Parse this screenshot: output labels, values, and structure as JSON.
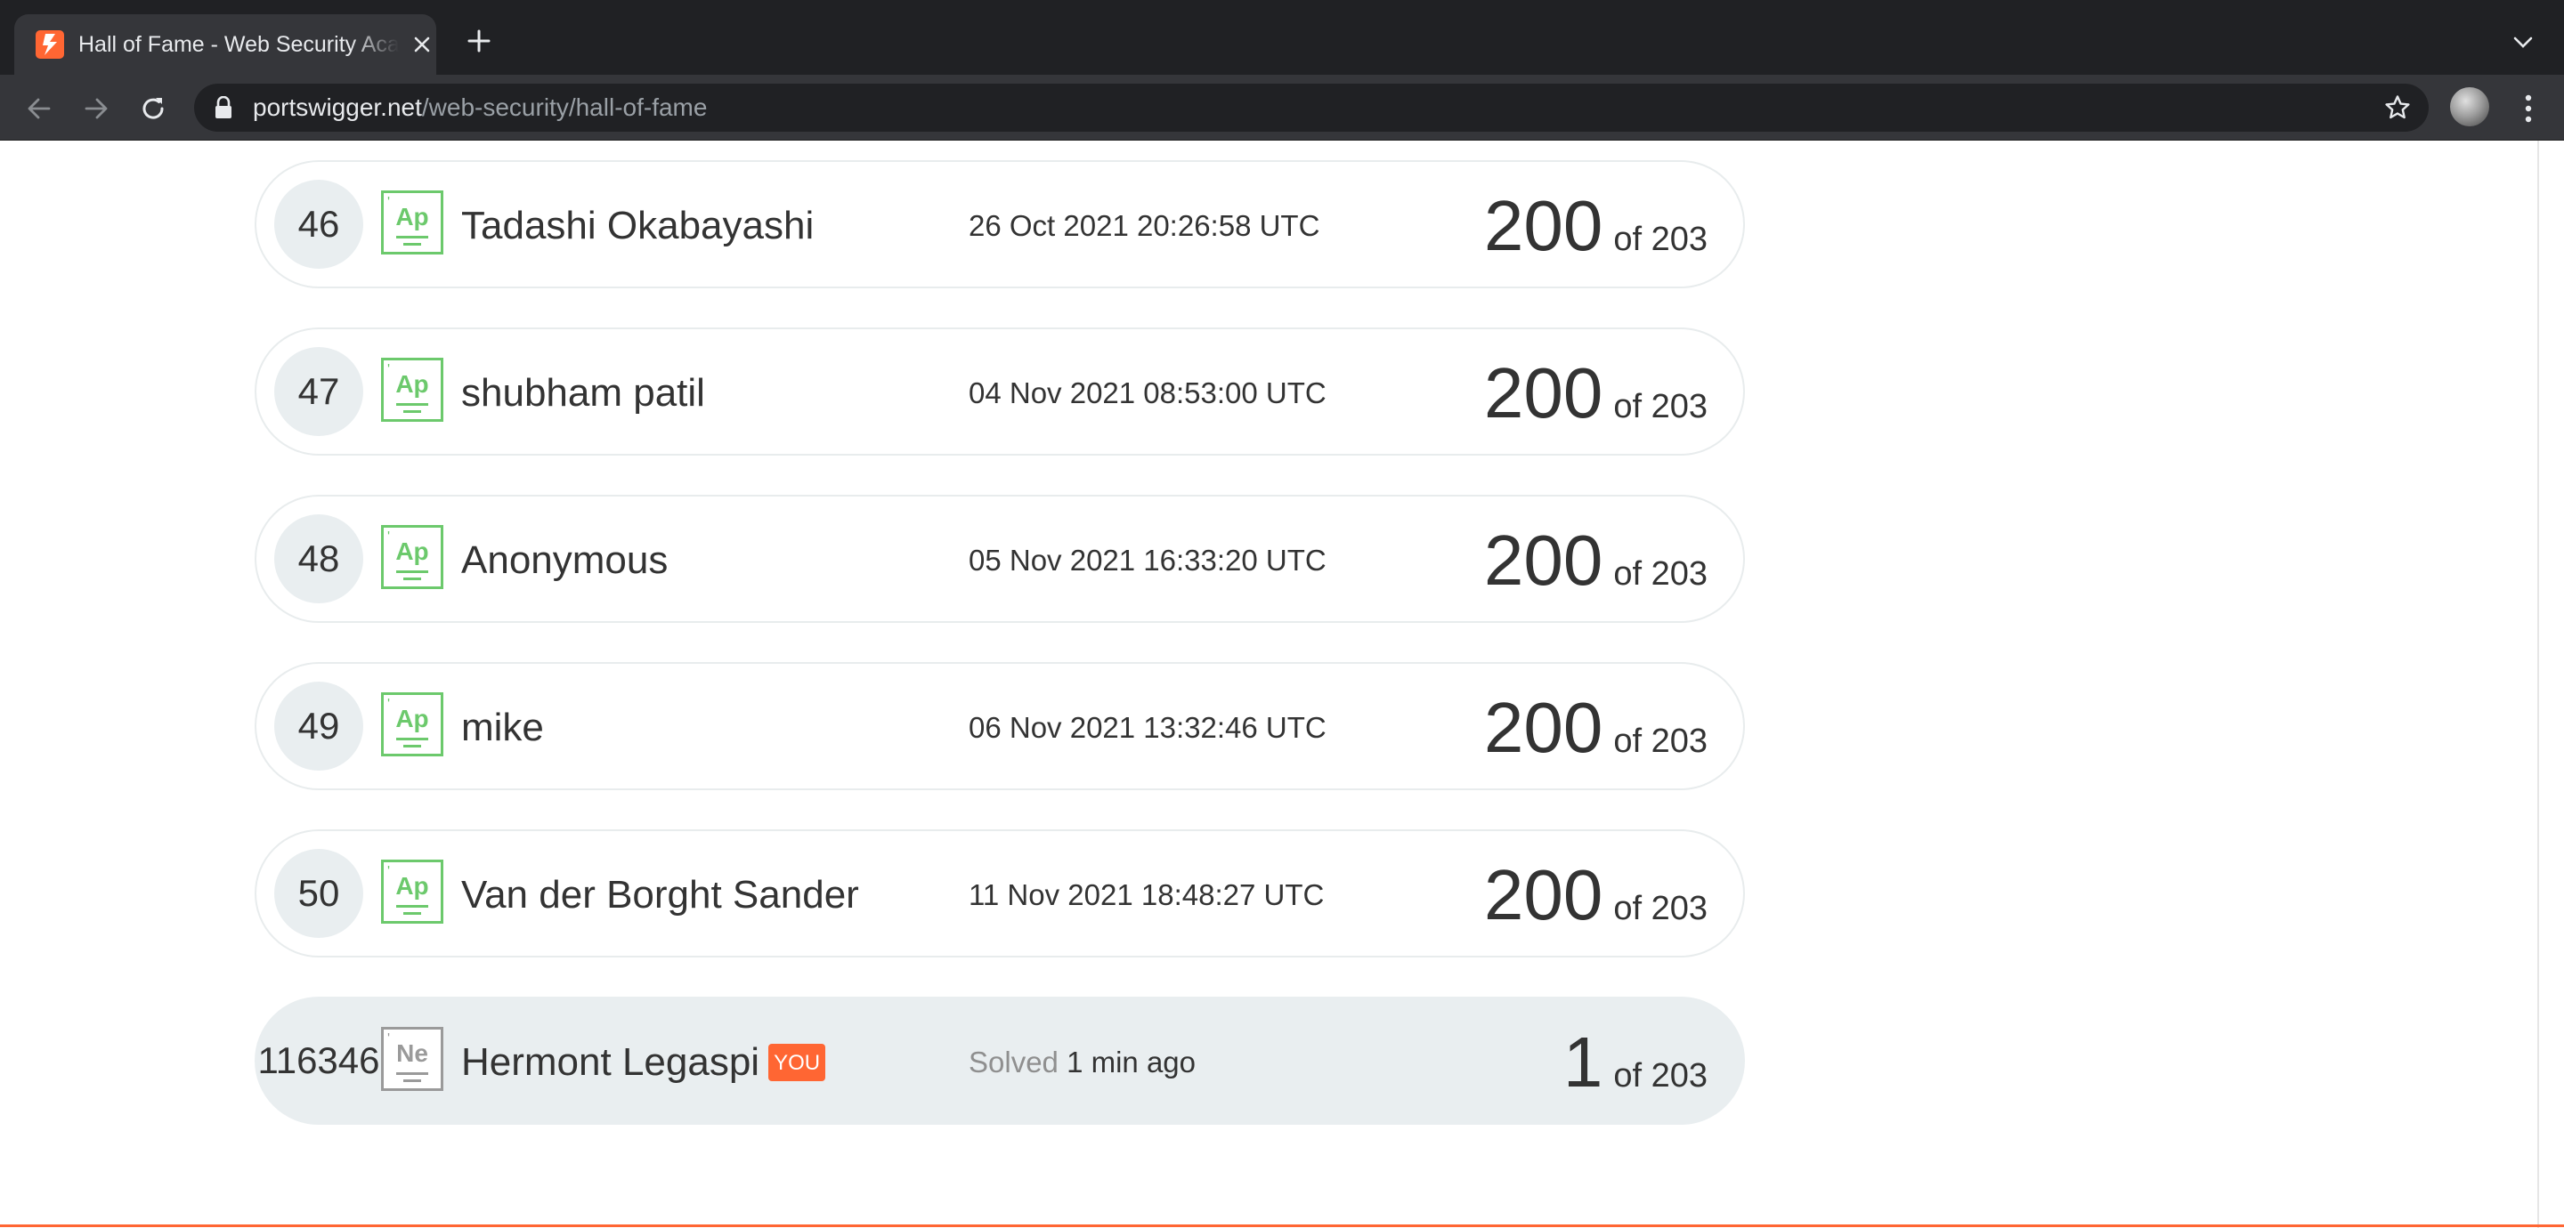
{
  "browser": {
    "tab_title": "Hall of Fame - Web Security Academy",
    "url_host": "portswigger.net",
    "url_path": "/web-security/hall-of-fame"
  },
  "leaderboard": {
    "rows": [
      {
        "rank": "46",
        "badge": "Ap",
        "name": "Tadashi Okabayashi",
        "date": "26 Oct 2021 20:26:58 UTC",
        "solved": "200",
        "total": "of 203"
      },
      {
        "rank": "47",
        "badge": "Ap",
        "name": "shubham patil",
        "date": "04 Nov 2021 08:53:00 UTC",
        "solved": "200",
        "total": "of 203"
      },
      {
        "rank": "48",
        "badge": "Ap",
        "name": "Anonymous",
        "date": "05 Nov 2021 16:33:20 UTC",
        "solved": "200",
        "total": "of 203"
      },
      {
        "rank": "49",
        "badge": "Ap",
        "name": "mike",
        "date": "06 Nov 2021 13:32:46 UTC",
        "solved": "200",
        "total": "of 203"
      },
      {
        "rank": "50",
        "badge": "Ap",
        "name": "Van der Borght Sander",
        "date": "11 Nov 2021 18:48:27 UTC",
        "solved": "200",
        "total": "of 203"
      }
    ],
    "current_user": {
      "rank": "116346",
      "badge": "Ne",
      "name": "Hermont Legaspi",
      "you_label": "YOU",
      "solved_prefix": "Solved",
      "solved_time": "1 min ago",
      "solved": "1",
      "total": "of 203"
    }
  },
  "colors": {
    "accent": "#ff6633",
    "badge_green": "#6cc96c",
    "badge_grey": "#9a9a9a",
    "row_highlight": "#e9eef0"
  }
}
